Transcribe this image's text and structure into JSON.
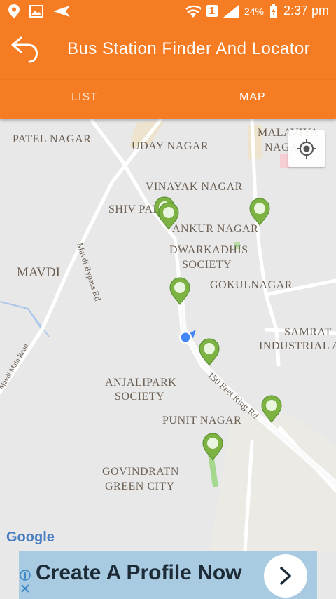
{
  "status": {
    "battery": "24%",
    "time": "2:37 pm",
    "sim": "1"
  },
  "app": {
    "title": "Bus Station Finder And Locator"
  },
  "tabs": [
    {
      "label": "LIST"
    },
    {
      "label": "MAP"
    }
  ],
  "map": {
    "labels": {
      "patel_nagar": "PATEL NAGAR",
      "uday_nagar": "UDAY NAGAR",
      "malaviya_nagar_1": "MALAVIYA",
      "malaviya_nagar_2": "NAGAR",
      "vinayak_nagar": "VINAYAK NAGAR",
      "shiv_park": "SHIV PAR",
      "ankur_nagar": "ANKUR NAGAR",
      "dwarkadhis_1": "DWARKADHIS",
      "dwarkadhis_2": "SOCIETY",
      "mavdi": "MAVDI",
      "mavdi_bypass": "Mavdi Bypass Rd",
      "gokulnagar": "GOKULNAGAR",
      "samrat_1": "SAMRAT",
      "samrat_2": "INDUSTRIAL AR",
      "mavdi_main": "Mavdi Main Road",
      "anjalipark_1": "ANJALIPARK",
      "anjalipark_2": "SOCIETY",
      "ring_rd": "150 Feet Ring Rd",
      "punit_nagar": "PUNIT NAGAR",
      "govindratn_1": "GOVINDRATN",
      "govindratn_2": "GREEN CITY"
    },
    "google_logo": "Google"
  },
  "ad": {
    "text": "Create A Profile Now"
  }
}
